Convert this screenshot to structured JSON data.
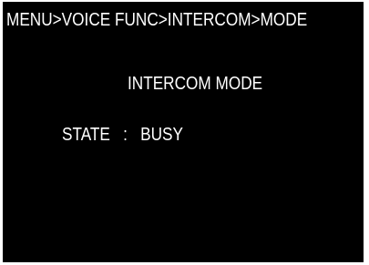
{
  "menu": {
    "breadcrumb": "MENU>VOICE FUNC>INTERCOM>MODE"
  },
  "page": {
    "title": "INTERCOM MODE",
    "state": {
      "label": "STATE",
      "separator": ":",
      "value": "BUSY"
    }
  },
  "colors": {
    "background": "#000000",
    "text": "#ffffff"
  }
}
